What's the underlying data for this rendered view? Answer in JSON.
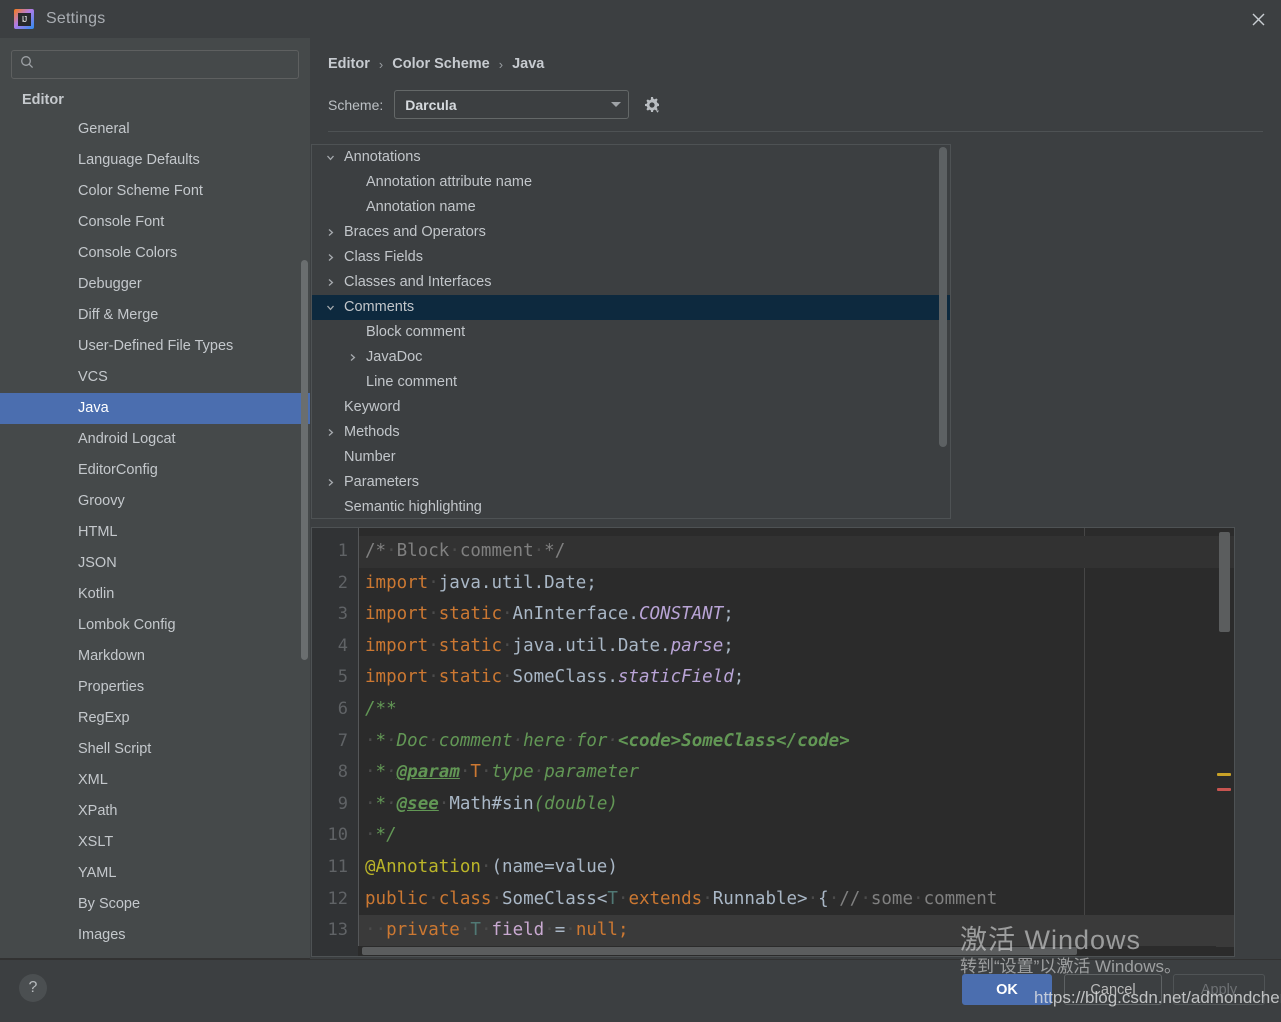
{
  "window": {
    "title": "Settings",
    "app_icon": "intellij-idea-icon",
    "close_icon": "close-icon"
  },
  "sidebar": {
    "search": {
      "value": "",
      "placeholder": "",
      "icon": "search-icon"
    },
    "group_title": "Editor",
    "selected": "Java",
    "items": [
      "General",
      "Language Defaults",
      "Color Scheme Font",
      "Console Font",
      "Console Colors",
      "Debugger",
      "Diff & Merge",
      "User-Defined File Types",
      "VCS",
      "Java",
      "Android Logcat",
      "EditorConfig",
      "Groovy",
      "HTML",
      "JSON",
      "Kotlin",
      "Lombok Config",
      "Markdown",
      "Properties",
      "RegExp",
      "Shell Script",
      "XML",
      "XPath",
      "XSLT",
      "YAML",
      "By Scope",
      "Images"
    ]
  },
  "content": {
    "breadcrumb": [
      "Editor",
      "Color Scheme",
      "Java"
    ],
    "breadcrumb_separator": "›",
    "scheme_label": "Scheme:",
    "scheme_value": "Darcula",
    "scheme_gear_icon": "gear-icon",
    "scheme_arrow_icon": "chevron-down-icon"
  },
  "attribute_tree": {
    "rows": [
      {
        "label": "Annotations",
        "indent": 0,
        "twisty": "expanded",
        "selected": false
      },
      {
        "label": "Annotation attribute name",
        "indent": 1,
        "twisty": "none",
        "selected": false
      },
      {
        "label": "Annotation name",
        "indent": 1,
        "twisty": "none",
        "selected": false
      },
      {
        "label": "Braces and Operators",
        "indent": 0,
        "twisty": "collapsed",
        "selected": false
      },
      {
        "label": "Class Fields",
        "indent": 0,
        "twisty": "collapsed",
        "selected": false
      },
      {
        "label": "Classes and Interfaces",
        "indent": 0,
        "twisty": "collapsed",
        "selected": false
      },
      {
        "label": "Comments",
        "indent": 0,
        "twisty": "expanded",
        "selected": true
      },
      {
        "label": "Block comment",
        "indent": 1,
        "twisty": "none",
        "selected": false
      },
      {
        "label": "JavaDoc",
        "indent": 1,
        "twisty": "collapsed",
        "selected": false
      },
      {
        "label": "Line comment",
        "indent": 1,
        "twisty": "none",
        "selected": false
      },
      {
        "label": "Keyword",
        "indent": 0,
        "twisty": "none",
        "selected": false
      },
      {
        "label": "Methods",
        "indent": 0,
        "twisty": "collapsed",
        "selected": false
      },
      {
        "label": "Number",
        "indent": 0,
        "twisty": "none",
        "selected": false
      },
      {
        "label": "Parameters",
        "indent": 0,
        "twisty": "collapsed",
        "selected": false
      },
      {
        "label": "Semantic highlighting",
        "indent": 0,
        "twisty": "none",
        "selected": false
      }
    ]
  },
  "preview": {
    "line_numbers": [
      "1",
      "2",
      "3",
      "4",
      "5",
      "6",
      "7",
      "8",
      "9",
      "10",
      "11",
      "12",
      "13"
    ],
    "lines": [
      "/* Block comment */",
      "import java.util.Date;",
      "import static AnInterface.CONSTANT;",
      "import static java.util.Date.parse;",
      "import static SomeClass.staticField;",
      "/**",
      " * Doc comment here for <code>SomeClass</code>",
      " * @param T type parameter",
      " * @see Math#sin(double)",
      " */",
      "@Annotation (name=value)",
      "public class SomeClass<T extends Runnable> { // some comment",
      "    private T field = null;"
    ],
    "marker_colors": {
      "warning": "#c9a227",
      "error": "#c75450"
    }
  },
  "buttons": {
    "help": "?",
    "ok": "OK",
    "cancel": "Cancel",
    "apply": "Apply"
  },
  "watermark": {
    "activate_title": "激活 Windows",
    "activate_subtitle": "转到“设置”以激活 Windows。",
    "url": "https://blog.csdn.net/admondchen"
  },
  "colors": {
    "dialog_bg": "#3c3f41",
    "sidebar_bg": "#45494a",
    "selection_blue": "#4b6eaf",
    "tree_selection": "#0d293e",
    "editor_bg": "#2b2b2b",
    "gutter_bg": "#313335"
  }
}
